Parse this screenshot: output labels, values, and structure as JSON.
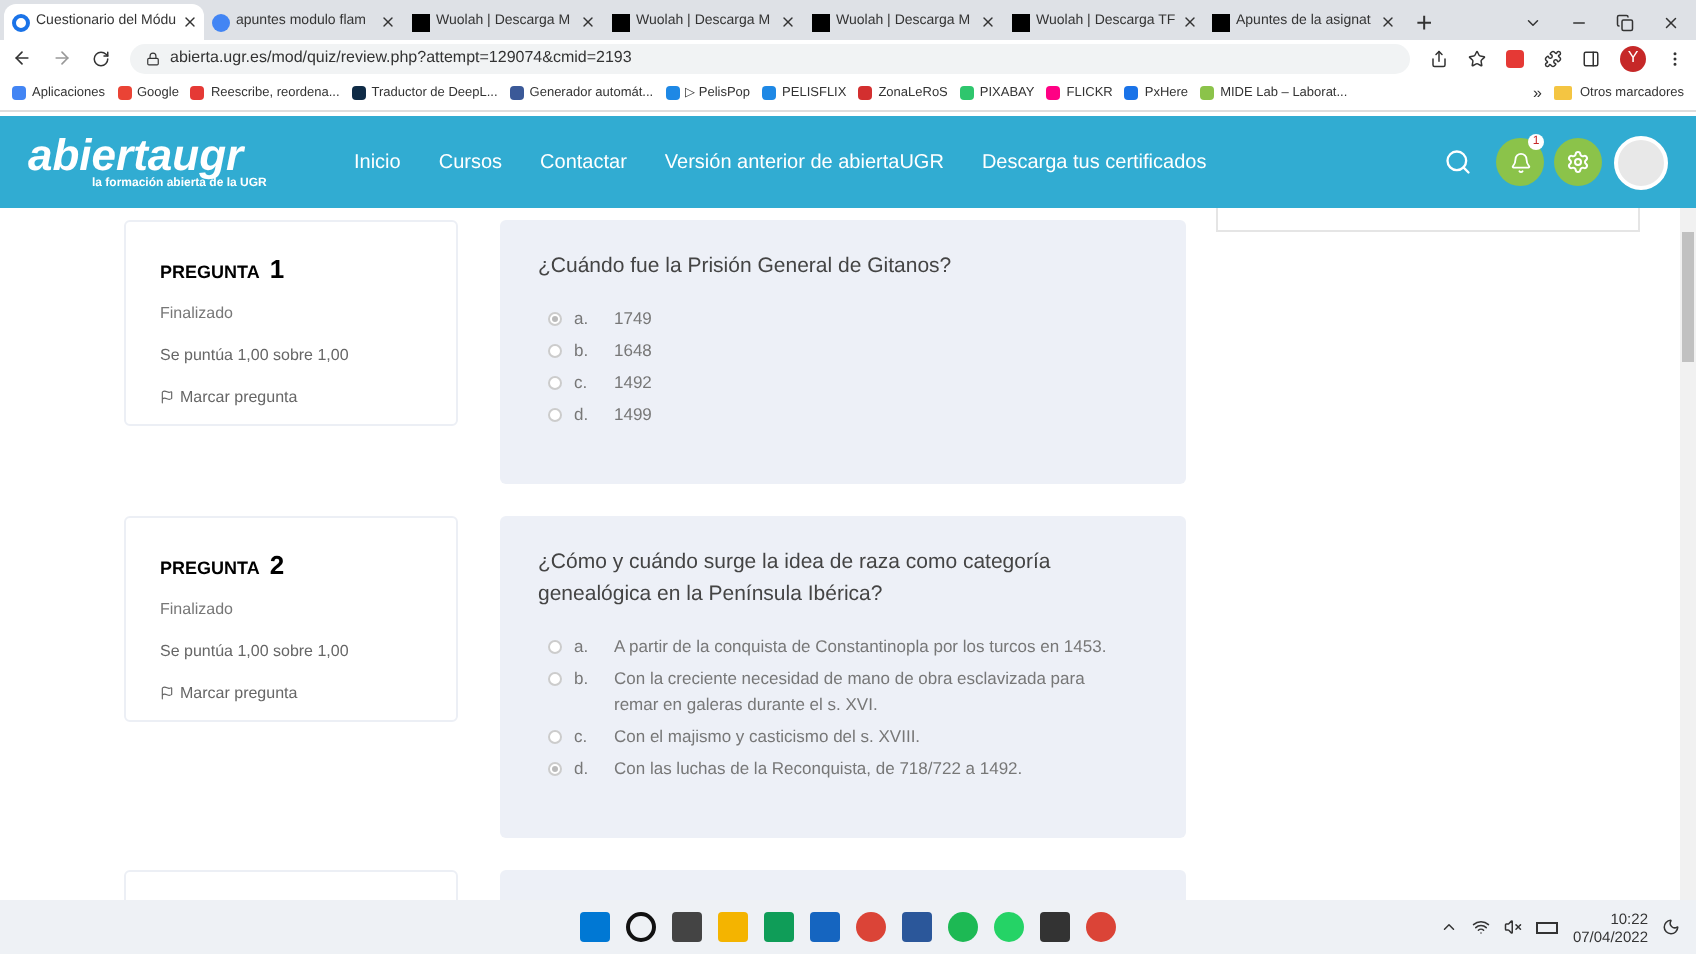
{
  "browser": {
    "tabs": [
      {
        "title": "Cuestionario del Módu",
        "selected": true
      },
      {
        "title": "apuntes modulo flam",
        "selected": false
      },
      {
        "title": "Wuolah | Descarga M",
        "selected": false
      },
      {
        "title": "Wuolah | Descarga M",
        "selected": false
      },
      {
        "title": "Wuolah | Descarga M",
        "selected": false
      },
      {
        "title": "Wuolah | Descarga TF",
        "selected": false
      },
      {
        "title": "Apuntes de la asignat",
        "selected": false
      }
    ],
    "new_tab": "+",
    "url": "abierta.ugr.es/mod/quiz/review.php?attempt=129074&cmid=2193",
    "profile_initial": "Y",
    "bookmarks": [
      "Aplicaciones",
      "Google",
      "Reescribe, reordena...",
      "Traductor de DeepL...",
      "Generador automát...",
      "▷ PelisPop",
      "PELISFLIX",
      "ZonaLeRoS",
      "PIXABAY",
      "FLICKR",
      "PxHere",
      "MIDE Lab – Laborat..."
    ],
    "more_bookmarks": "»",
    "other_bookmarks": "Otros marcadores"
  },
  "site": {
    "logo": "abiertaugr",
    "logo_tagline": "la formación abierta de la UGR",
    "nav": [
      "Inicio",
      "Cursos",
      "Contactar",
      "Versión anterior de abiertaUGR",
      "Descarga tus certificados"
    ],
    "notification_count": "1"
  },
  "questions": [
    {
      "label": "PREGUNTA",
      "number": "1",
      "status": "Finalizado",
      "score": "Se puntúa 1,00 sobre 1,00",
      "flag": "Marcar pregunta",
      "text": "¿Cuándo fue la Prisión General de Gitanos?",
      "options": [
        {
          "letter": "a.",
          "text": "1749",
          "selected": true
        },
        {
          "letter": "b.",
          "text": "1648",
          "selected": false
        },
        {
          "letter": "c.",
          "text": "1492",
          "selected": false
        },
        {
          "letter": "d.",
          "text": "1499",
          "selected": false
        }
      ]
    },
    {
      "label": "PREGUNTA",
      "number": "2",
      "status": "Finalizado",
      "score": "Se puntúa 1,00 sobre 1,00",
      "flag": "Marcar pregunta",
      "text": "¿Cómo y cuándo surge la idea de raza como categoría genealógica en la Península Ibérica?",
      "options": [
        {
          "letter": "a.",
          "text": "A partir de la conquista de Constantinopla por los turcos en 1453.",
          "selected": false
        },
        {
          "letter": "b.",
          "text": "Con la creciente necesidad de mano de obra esclavizada para remar en galeras durante el s. XVI.",
          "selected": false
        },
        {
          "letter": "c.",
          "text": "Con el majismo y casticismo del s. XVIII.",
          "selected": false
        },
        {
          "letter": "d.",
          "text": "Con las luchas de la Reconquista, de 718/722 a 1492.",
          "selected": true
        }
      ]
    }
  ],
  "taskbar": {
    "time": "10:22",
    "date": "07/04/2022"
  }
}
